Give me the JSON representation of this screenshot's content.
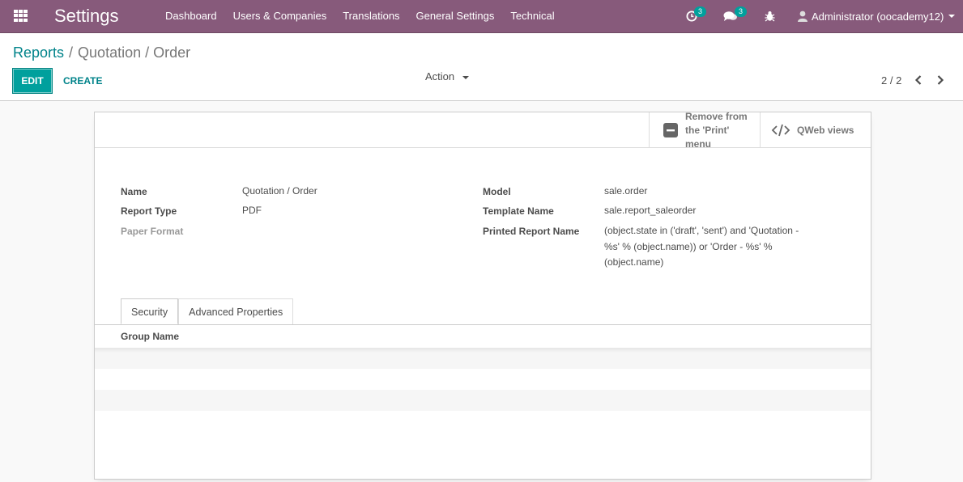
{
  "navbar": {
    "app_title": "Settings",
    "menu": [
      "Dashboard",
      "Users & Companies",
      "Translations",
      "General Settings",
      "Technical"
    ],
    "activity_count": "3",
    "messages_count": "3",
    "user_label": "Administrator (oocademy12)"
  },
  "control_panel": {
    "breadcrumb_root": "Reports",
    "breadcrumb_current": "Quotation / Order",
    "edit_label": "EDIT",
    "create_label": "CREATE",
    "action_label": "Action",
    "pager_value": "2 / 2"
  },
  "button_box": {
    "remove_line1": "Remove from",
    "remove_line2": "the 'Print'",
    "remove_line3": "menu",
    "qweb_label": "QWeb views"
  },
  "fields": {
    "name_label": "Name",
    "name_value": "Quotation / Order",
    "report_type_label": "Report Type",
    "report_type_value": "PDF",
    "paper_format_label": "Paper Format",
    "model_label": "Model",
    "model_value": "sale.order",
    "template_name_label": "Template Name",
    "template_name_value": "sale.report_saleorder",
    "printed_name_label": "Printed Report Name",
    "printed_name_line1": "(object.state in ('draft', 'sent') and 'Quotation -",
    "printed_name_line2": "%s' % (object.name)) or 'Order - %s' %",
    "printed_name_line3": "(object.name)"
  },
  "tabs": [
    "Security",
    "Advanced Properties"
  ],
  "security_table": {
    "column_header": "Group Name"
  },
  "colors": {
    "navbar": "#875a7b",
    "primary": "#00a09d",
    "link": "#00838a"
  }
}
